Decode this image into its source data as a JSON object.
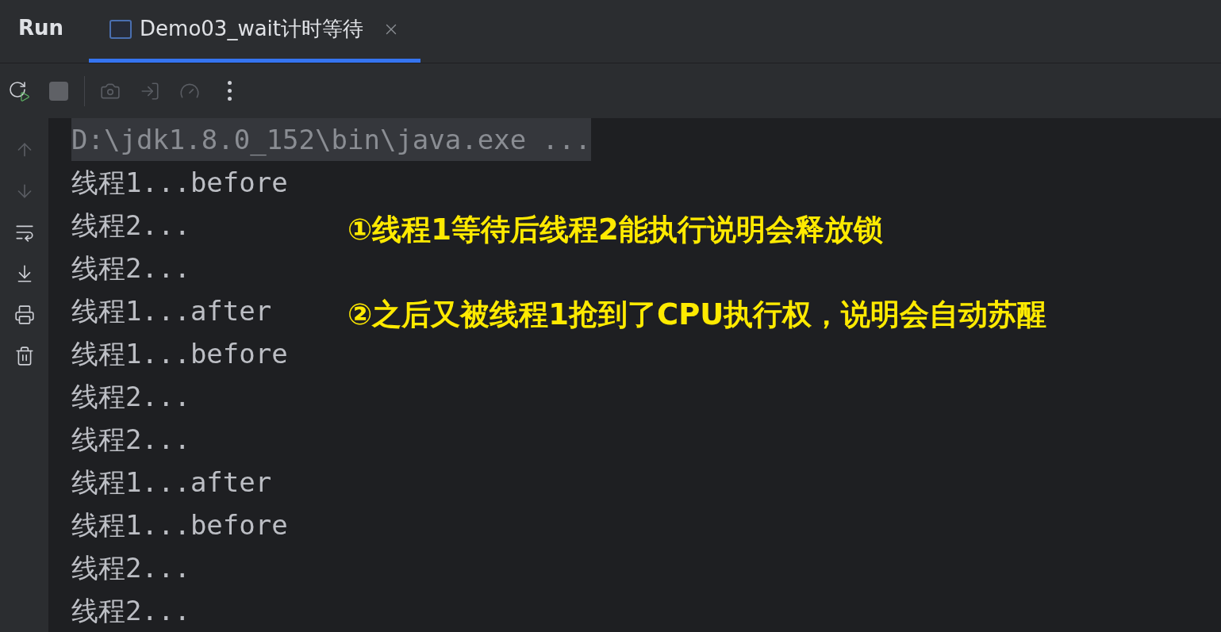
{
  "header": {
    "title": "Run"
  },
  "tabs": [
    {
      "label": "Demo03_wait计时等待",
      "selected": true
    }
  ],
  "toolbar": [
    {
      "kind": "rerun",
      "disabled": false
    },
    {
      "kind": "stop",
      "disabled": false
    },
    {
      "kind": "camera",
      "disabled": true
    },
    {
      "kind": "import",
      "disabled": true
    },
    {
      "kind": "gauge",
      "disabled": true
    },
    {
      "kind": "more",
      "disabled": false
    }
  ],
  "side_toolbar": [
    {
      "kind": "up",
      "disabled": true
    },
    {
      "kind": "down",
      "disabled": true
    },
    {
      "kind": "wrap",
      "disabled": false
    },
    {
      "kind": "scroll-end",
      "disabled": false
    },
    {
      "kind": "print",
      "disabled": false
    },
    {
      "kind": "clear",
      "disabled": false
    }
  ],
  "console": [
    {
      "kind": "command",
      "text": "D:\\jdk1.8.0_152\\bin\\java.exe ..."
    },
    {
      "kind": "output",
      "text": "线程1...before"
    },
    {
      "kind": "output",
      "text": "线程2..."
    },
    {
      "kind": "output",
      "text": "线程2..."
    },
    {
      "kind": "output",
      "text": "线程1...after"
    },
    {
      "kind": "output",
      "text": "线程1...before"
    },
    {
      "kind": "output",
      "text": "线程2..."
    },
    {
      "kind": "output",
      "text": "线程2..."
    },
    {
      "kind": "output",
      "text": "线程1...after"
    },
    {
      "kind": "output",
      "text": "线程1...before"
    },
    {
      "kind": "output",
      "text": "线程2..."
    },
    {
      "kind": "output",
      "text": "线程2..."
    }
  ],
  "annotations": [
    "①线程1等待后线程2能执行说明会释放锁",
    "②之后又被线程1抢到了CPU执行权，说明会自动苏醒"
  ]
}
